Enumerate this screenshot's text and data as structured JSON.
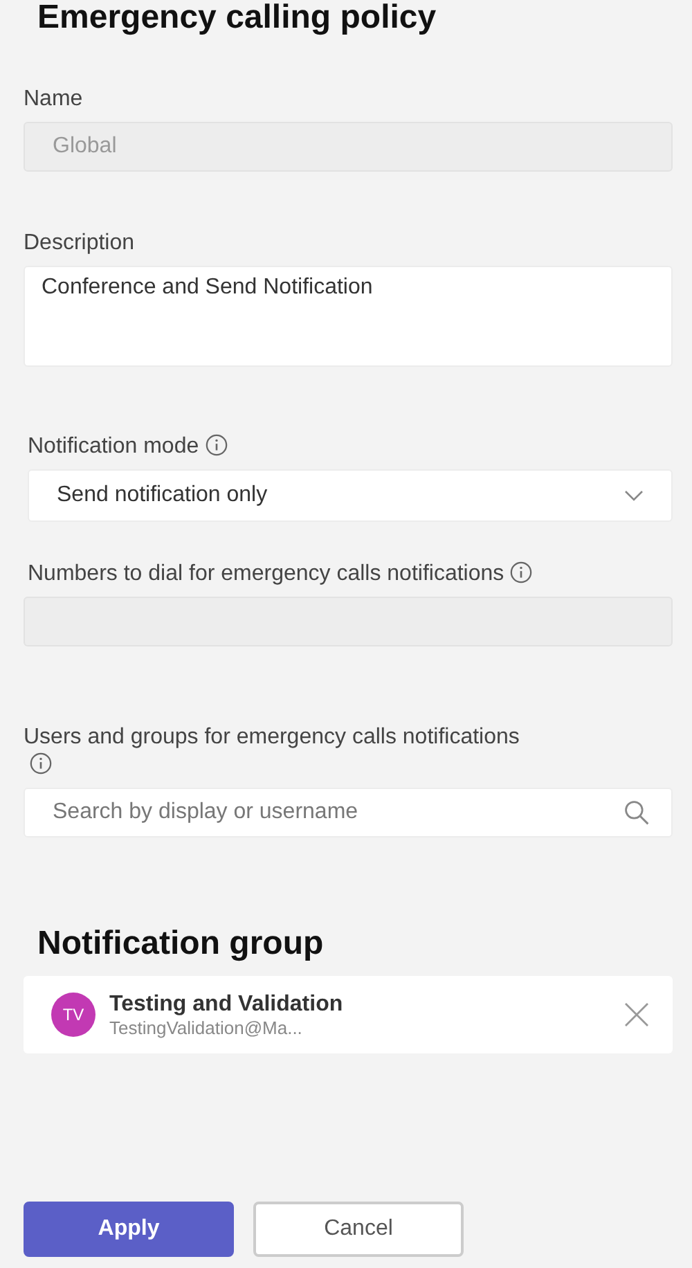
{
  "title": "Emergency calling policy",
  "fields": [
    {
      "kind": "text",
      "label": "Name",
      "value": "Global",
      "disabled": true,
      "info": false
    },
    {
      "kind": "textarea",
      "label": "Description",
      "value": "Conference and Send Notification",
      "disabled": false,
      "info": false
    },
    {
      "kind": "dropdown",
      "label": "Notification mode",
      "value": "Send notification only",
      "info": true
    },
    {
      "kind": "text",
      "label": "Numbers to dial for emergency calls notifications",
      "disabled": true,
      "info": true
    },
    {
      "kind": "search",
      "label": "Users and groups for emergency calls notifications",
      "placeholder": "Search by display or username",
      "info": true
    }
  ],
  "notification_group": {
    "heading": "Notification group",
    "members": [
      {
        "initials": "TV",
        "color": "#c239b3",
        "name": "Testing and Validation",
        "email": "TestingValidation@Ma..."
      }
    ]
  },
  "buttons": [
    {
      "label": "Apply",
      "kind": "primary"
    },
    {
      "label": "Cancel",
      "kind": "secondary"
    }
  ]
}
